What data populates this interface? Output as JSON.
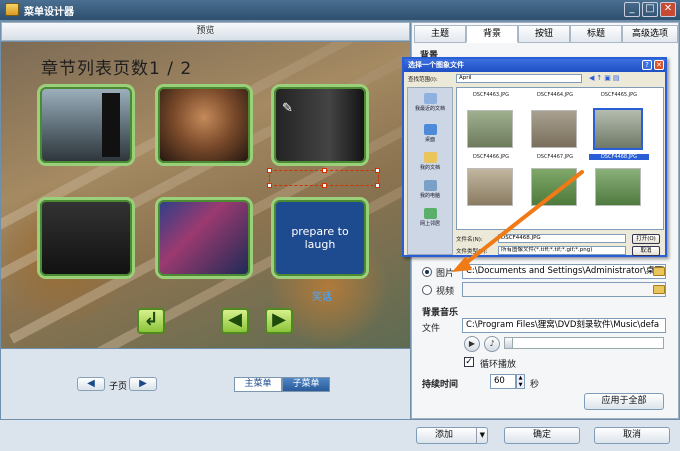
{
  "window": {
    "title": "菜单设计器",
    "controls": [
      "_",
      "□",
      "✕"
    ]
  },
  "preview": {
    "header": "预览",
    "canvas_title": "章节列表页数1 / 2",
    "thumbnails": [
      {
        "caption": "",
        "kind": "city"
      },
      {
        "caption": "",
        "kind": "girl"
      },
      {
        "caption": "",
        "kind": "calligraphy"
      },
      {
        "caption": "",
        "kind": "dark"
      },
      {
        "caption": "",
        "kind": "crowd"
      },
      {
        "caption": "笑话",
        "kind": "text",
        "text": "prepare to laugh"
      }
    ],
    "nav_buttons": {
      "back": "↲",
      "prev": "◀",
      "next": "▶"
    }
  },
  "pager": {
    "prev_label": "◀",
    "page_label": "子页",
    "next_label": "▶",
    "main_menu": "主菜单",
    "sub_menu": "子菜单"
  },
  "tabs": [
    "主题",
    "背景",
    "按钮",
    "标题",
    "高级选项"
  ],
  "active_tab": "背景",
  "bg_panel": {
    "section_label_partial": "背景",
    "option_image": "图片",
    "image_path": "C:\\Documents and Settings\\Administrator\\桌面\\",
    "option_video": "视频",
    "video_path": "",
    "music_section": "背景音乐",
    "file_label": "文件",
    "music_path": "C:\\Program Files\\狸窝\\DVD刻录软件\\Music\\defa",
    "loop_label": "循环播放",
    "duration_label": "持续时间",
    "duration_value": "60",
    "duration_unit": "秒",
    "apply_all": "应用于全部"
  },
  "bottom": {
    "add": "添加",
    "ok": "确定",
    "cancel": "取消"
  },
  "dialog": {
    "title": "选择一个图象文件",
    "lookin_label": "查找范围(I):",
    "lookin_value": "April",
    "places": [
      "我最近的文档",
      "桌面",
      "我的文档",
      "我的电脑",
      "网上邻居"
    ],
    "files": [
      "DSCF4463.JPG",
      "DSCF4464.JPG",
      "DSCF4465.JPG",
      "DSCF4466.JPG",
      "DSCF4467.JPG",
      "DSCF4468.JPG"
    ],
    "selected_file": "DSCF4468.JPG",
    "filename_label": "文件名(N):",
    "filename_value": "DSCF4468.JPG",
    "filetype_label": "文件类型(T):",
    "filetype_value": "所有图像文件(*.tiff;*.tif;*.gif;*.png)",
    "open": "打开(O)",
    "cancel": "取消"
  },
  "colors": {
    "accent": "#2a5ed6",
    "arrow": "#f07a16",
    "caption": "#4aa8ff",
    "thumb_border": "#9bd07a"
  }
}
